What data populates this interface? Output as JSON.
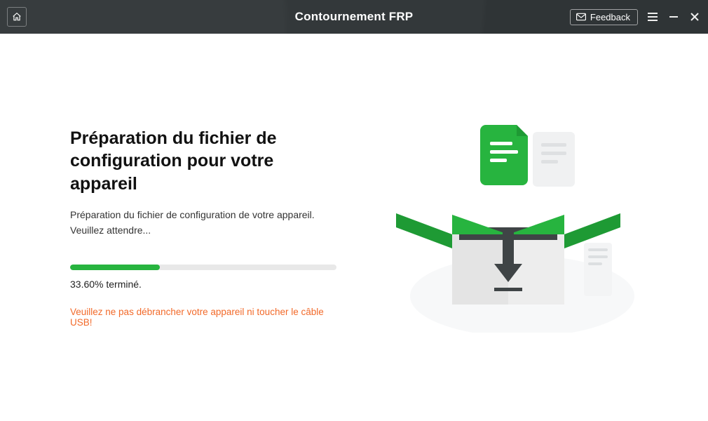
{
  "titlebar": {
    "title": "Contournement FRP",
    "feedback_label": "Feedback"
  },
  "main": {
    "heading": "Préparation du fichier de configuration pour votre appareil",
    "subtext": "Préparation du fichier de configuration de votre appareil. Veuillez attendre...",
    "progress_percent": 33.6,
    "progress_label": "33.60% terminé.",
    "warning": "Veuillez ne pas débrancher votre appareil ni toucher le câble USB!"
  }
}
